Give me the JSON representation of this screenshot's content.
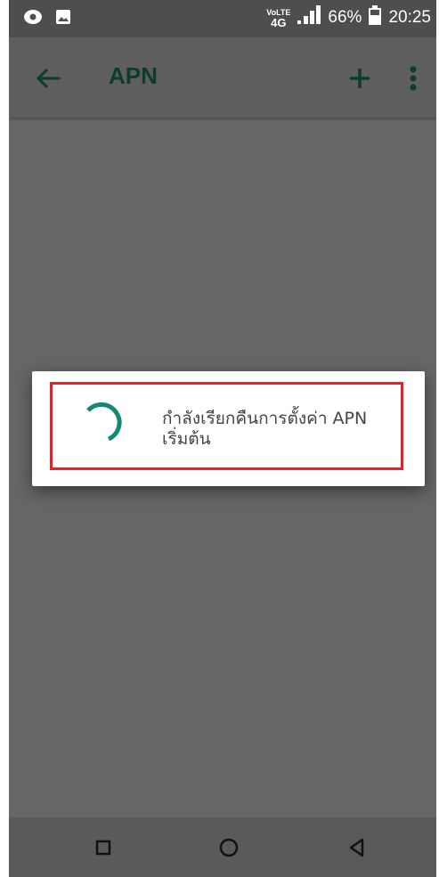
{
  "status_bar": {
    "left_icons": [
      "notification-dot-icon",
      "image-icon"
    ],
    "network_tag_top": "VoLTE",
    "network_tag_bottom": "4G",
    "signal_icon": "signal-bars-icon",
    "battery_percent": "66%",
    "battery_icon": "battery-icon",
    "time": "20:25"
  },
  "toolbar": {
    "back_icon": "arrow-back-icon",
    "title": "APN",
    "add_icon": "plus-icon",
    "more_icon": "more-vert-icon"
  },
  "dialog": {
    "spinner_icon": "progress-spinner-icon",
    "message_line1": "กำลังเรียกคืนการตั้งค่า APN",
    "message_line2": "เริ่มต้น"
  },
  "nav_bar": {
    "recents_icon": "square-recents-icon",
    "home_icon": "circle-home-icon",
    "back_icon": "triangle-back-icon"
  },
  "colors": {
    "accent": "#0c3b30",
    "spinner": "#0f8b74",
    "highlight": "#e2232b",
    "dim_overlay": "#666666"
  }
}
